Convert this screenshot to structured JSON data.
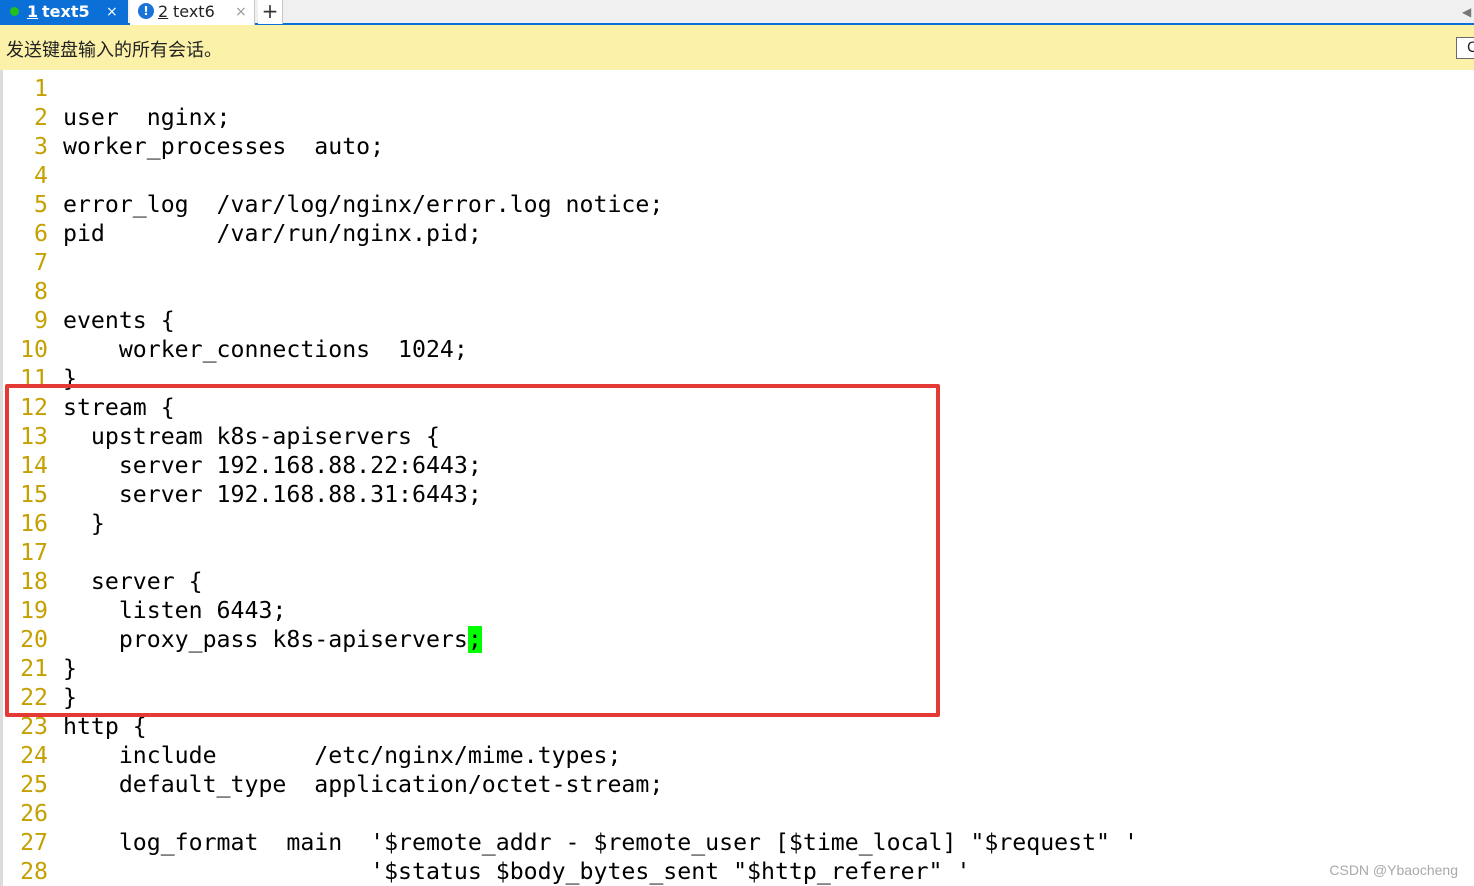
{
  "tabs": [
    {
      "number": "1",
      "name": "text5",
      "close": "×",
      "active": true
    },
    {
      "number": "2",
      "name": "text6",
      "close": "×",
      "active": false,
      "status_icon": "!"
    }
  ],
  "new_tab_label": "+",
  "notice": {
    "text": "发送键盘输入的所有会话。",
    "button_text": "C"
  },
  "editor": {
    "cursor_char": ";",
    "lines": [
      {
        "n": "1",
        "text": ""
      },
      {
        "n": "2",
        "text": "user  nginx;"
      },
      {
        "n": "3",
        "text": "worker_processes  auto;"
      },
      {
        "n": "4",
        "text": ""
      },
      {
        "n": "5",
        "text": "error_log  /var/log/nginx/error.log notice;"
      },
      {
        "n": "6",
        "text": "pid        /var/run/nginx.pid;"
      },
      {
        "n": "7",
        "text": ""
      },
      {
        "n": "8",
        "text": ""
      },
      {
        "n": "9",
        "text": "events {"
      },
      {
        "n": "10",
        "text": "    worker_connections  1024;"
      },
      {
        "n": "11",
        "text": "}"
      },
      {
        "n": "12",
        "text": "stream {"
      },
      {
        "n": "13",
        "text": "  upstream k8s-apiservers {"
      },
      {
        "n": "14",
        "text": "    server 192.168.88.22:6443;"
      },
      {
        "n": "15",
        "text": "    server 192.168.88.31:6443;"
      },
      {
        "n": "16",
        "text": "  }"
      },
      {
        "n": "17",
        "text": ""
      },
      {
        "n": "18",
        "text": "  server {"
      },
      {
        "n": "19",
        "text": "    listen 6443;"
      },
      {
        "n": "20",
        "text": "    proxy_pass k8s-apiservers"
      },
      {
        "n": "21",
        "text": "}"
      },
      {
        "n": "22",
        "text": "}"
      },
      {
        "n": "23",
        "text": "http {"
      },
      {
        "n": "24",
        "text": "    include       /etc/nginx/mime.types;"
      },
      {
        "n": "25",
        "text": "    default_type  application/octet-stream;"
      },
      {
        "n": "26",
        "text": ""
      },
      {
        "n": "27",
        "text": "    log_format  main  '$remote_addr - $remote_user [$time_local] \"$request\" '"
      },
      {
        "n": "28",
        "text": "                      '$status $body_bytes_sent \"$http_referer\" '"
      }
    ]
  },
  "watermark": "CSDN @Ybaocheng",
  "colors": {
    "tab_active": "#0a6fd6",
    "notice_bg": "#fbf1a9",
    "line_number": "#c4a000",
    "highlight_box": "#e53935",
    "cursor": "#00ff00"
  }
}
